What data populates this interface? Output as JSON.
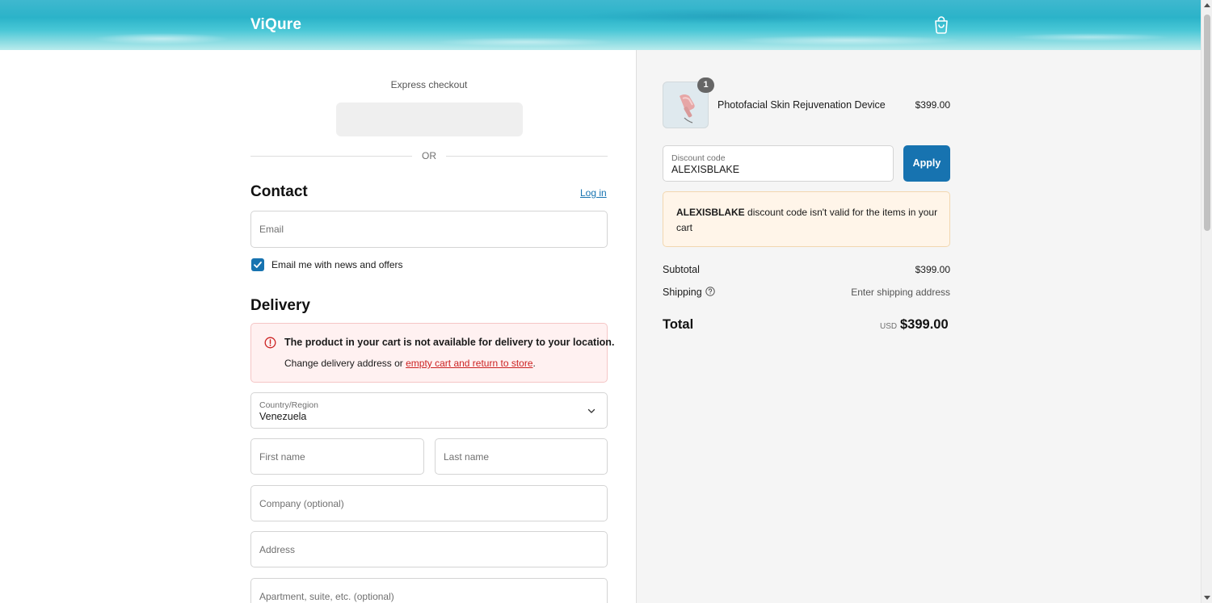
{
  "header": {
    "logo": "ViQure",
    "cart_icon": "shopping-bag-icon"
  },
  "express": {
    "label": "Express checkout",
    "divider": "OR"
  },
  "contact": {
    "heading": "Contact",
    "login_link": "Log in",
    "email_placeholder": "Email",
    "newsletter_label": "Email me with news and offers",
    "newsletter_checked": true
  },
  "delivery": {
    "heading": "Delivery",
    "error_title": "The product in your cart is not available for delivery to your location.",
    "error_body_prefix": "Change delivery address or ",
    "error_body_link": "empty cart and return to store",
    "error_body_suffix": ".",
    "country_label": "Country/Region",
    "country_value": "Venezuela",
    "first_name_placeholder": "First name",
    "last_name_placeholder": "Last name",
    "company_placeholder": "Company (optional)",
    "address_placeholder": "Address",
    "apartment_placeholder": "Apartment, suite, etc. (optional)"
  },
  "order": {
    "product_name": "Photofacial Skin Rejuvenation Device",
    "product_price": "$399.00",
    "quantity": "1",
    "discount_label": "Discount code",
    "discount_value": "ALEXISBLAKE",
    "apply_label": "Apply",
    "discount_error_code": "ALEXISBLAKE",
    "discount_error_text": " discount code isn't valid for the items in your cart",
    "subtotal_label": "Subtotal",
    "subtotal_value": "$399.00",
    "shipping_label": "Shipping",
    "shipping_value": "Enter shipping address",
    "total_label": "Total",
    "total_currency": "USD",
    "total_value": "$399.00"
  },
  "colors": {
    "accent": "#1773b0",
    "error_bg": "#fff1f1",
    "warning_bg": "#fff5e9",
    "summary_bg": "#f5f5f5"
  }
}
